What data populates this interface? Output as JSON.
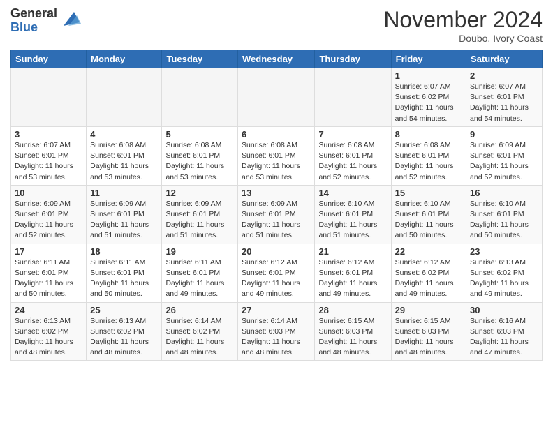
{
  "header": {
    "logo_general": "General",
    "logo_blue": "Blue",
    "month_title": "November 2024",
    "location": "Doubo, Ivory Coast"
  },
  "weekdays": [
    "Sunday",
    "Monday",
    "Tuesday",
    "Wednesday",
    "Thursday",
    "Friday",
    "Saturday"
  ],
  "weeks": [
    [
      {
        "day": "",
        "info": ""
      },
      {
        "day": "",
        "info": ""
      },
      {
        "day": "",
        "info": ""
      },
      {
        "day": "",
        "info": ""
      },
      {
        "day": "",
        "info": ""
      },
      {
        "day": "1",
        "info": "Sunrise: 6:07 AM\nSunset: 6:02 PM\nDaylight: 11 hours\nand 54 minutes."
      },
      {
        "day": "2",
        "info": "Sunrise: 6:07 AM\nSunset: 6:01 PM\nDaylight: 11 hours\nand 54 minutes."
      }
    ],
    [
      {
        "day": "3",
        "info": "Sunrise: 6:07 AM\nSunset: 6:01 PM\nDaylight: 11 hours\nand 53 minutes."
      },
      {
        "day": "4",
        "info": "Sunrise: 6:08 AM\nSunset: 6:01 PM\nDaylight: 11 hours\nand 53 minutes."
      },
      {
        "day": "5",
        "info": "Sunrise: 6:08 AM\nSunset: 6:01 PM\nDaylight: 11 hours\nand 53 minutes."
      },
      {
        "day": "6",
        "info": "Sunrise: 6:08 AM\nSunset: 6:01 PM\nDaylight: 11 hours\nand 53 minutes."
      },
      {
        "day": "7",
        "info": "Sunrise: 6:08 AM\nSunset: 6:01 PM\nDaylight: 11 hours\nand 52 minutes."
      },
      {
        "day": "8",
        "info": "Sunrise: 6:08 AM\nSunset: 6:01 PM\nDaylight: 11 hours\nand 52 minutes."
      },
      {
        "day": "9",
        "info": "Sunrise: 6:09 AM\nSunset: 6:01 PM\nDaylight: 11 hours\nand 52 minutes."
      }
    ],
    [
      {
        "day": "10",
        "info": "Sunrise: 6:09 AM\nSunset: 6:01 PM\nDaylight: 11 hours\nand 52 minutes."
      },
      {
        "day": "11",
        "info": "Sunrise: 6:09 AM\nSunset: 6:01 PM\nDaylight: 11 hours\nand 51 minutes."
      },
      {
        "day": "12",
        "info": "Sunrise: 6:09 AM\nSunset: 6:01 PM\nDaylight: 11 hours\nand 51 minutes."
      },
      {
        "day": "13",
        "info": "Sunrise: 6:09 AM\nSunset: 6:01 PM\nDaylight: 11 hours\nand 51 minutes."
      },
      {
        "day": "14",
        "info": "Sunrise: 6:10 AM\nSunset: 6:01 PM\nDaylight: 11 hours\nand 51 minutes."
      },
      {
        "day": "15",
        "info": "Sunrise: 6:10 AM\nSunset: 6:01 PM\nDaylight: 11 hours\nand 50 minutes."
      },
      {
        "day": "16",
        "info": "Sunrise: 6:10 AM\nSunset: 6:01 PM\nDaylight: 11 hours\nand 50 minutes."
      }
    ],
    [
      {
        "day": "17",
        "info": "Sunrise: 6:11 AM\nSunset: 6:01 PM\nDaylight: 11 hours\nand 50 minutes."
      },
      {
        "day": "18",
        "info": "Sunrise: 6:11 AM\nSunset: 6:01 PM\nDaylight: 11 hours\nand 50 minutes."
      },
      {
        "day": "19",
        "info": "Sunrise: 6:11 AM\nSunset: 6:01 PM\nDaylight: 11 hours\nand 49 minutes."
      },
      {
        "day": "20",
        "info": "Sunrise: 6:12 AM\nSunset: 6:01 PM\nDaylight: 11 hours\nand 49 minutes."
      },
      {
        "day": "21",
        "info": "Sunrise: 6:12 AM\nSunset: 6:01 PM\nDaylight: 11 hours\nand 49 minutes."
      },
      {
        "day": "22",
        "info": "Sunrise: 6:12 AM\nSunset: 6:02 PM\nDaylight: 11 hours\nand 49 minutes."
      },
      {
        "day": "23",
        "info": "Sunrise: 6:13 AM\nSunset: 6:02 PM\nDaylight: 11 hours\nand 49 minutes."
      }
    ],
    [
      {
        "day": "24",
        "info": "Sunrise: 6:13 AM\nSunset: 6:02 PM\nDaylight: 11 hours\nand 48 minutes."
      },
      {
        "day": "25",
        "info": "Sunrise: 6:13 AM\nSunset: 6:02 PM\nDaylight: 11 hours\nand 48 minutes."
      },
      {
        "day": "26",
        "info": "Sunrise: 6:14 AM\nSunset: 6:02 PM\nDaylight: 11 hours\nand 48 minutes."
      },
      {
        "day": "27",
        "info": "Sunrise: 6:14 AM\nSunset: 6:03 PM\nDaylight: 11 hours\nand 48 minutes."
      },
      {
        "day": "28",
        "info": "Sunrise: 6:15 AM\nSunset: 6:03 PM\nDaylight: 11 hours\nand 48 minutes."
      },
      {
        "day": "29",
        "info": "Sunrise: 6:15 AM\nSunset: 6:03 PM\nDaylight: 11 hours\nand 48 minutes."
      },
      {
        "day": "30",
        "info": "Sunrise: 6:16 AM\nSunset: 6:03 PM\nDaylight: 11 hours\nand 47 minutes."
      }
    ]
  ]
}
